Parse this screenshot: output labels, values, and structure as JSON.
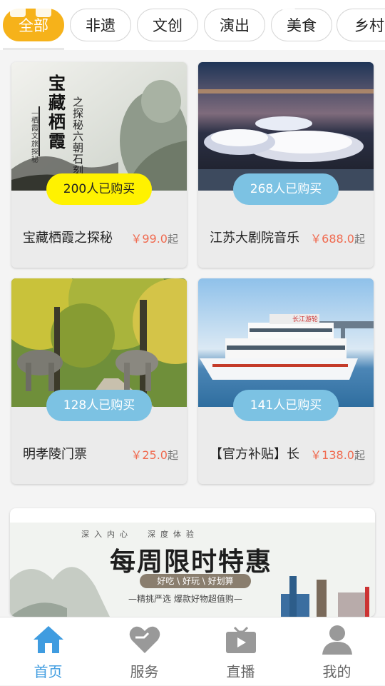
{
  "tabs": [
    {
      "label": "全部",
      "active": true
    },
    {
      "label": "非遗"
    },
    {
      "label": "文创"
    },
    {
      "label": "演出"
    },
    {
      "label": "美食"
    },
    {
      "label": "乡村游"
    }
  ],
  "products": [
    {
      "title": "宝藏栖霞之探秘",
      "price": "￥99.0",
      "unit": "起",
      "sold": "200人已购买",
      "image_text": {
        "main": "宝藏栖霞",
        "sub": "之探秘六朝石刻",
        "side": "—栖霞文旅探秘"
      }
    },
    {
      "title": "江苏大剧院音乐",
      "price": "￥688.0",
      "unit": "起",
      "sold": "268人已购买"
    },
    {
      "title": "明孝陵门票",
      "price": "￥25.0",
      "unit": "起",
      "sold": "128人已购买"
    },
    {
      "title": "【官方补贴】长",
      "price": "￥138.0",
      "unit": "起",
      "sold": "141人已购买",
      "image_text": {
        "boat": "长江游轮"
      }
    }
  ],
  "banner": {
    "top_line": "深  入  内  心        深  度  体  验",
    "title": "每周限时特惠",
    "tags": "好吃 \\ 好玩 \\ 好划算",
    "slogan": "—精挑严选 爆款好物超值购—"
  },
  "nav": [
    {
      "label": "首页",
      "icon": "home-icon",
      "active": true
    },
    {
      "label": "服务",
      "icon": "heart-icon"
    },
    {
      "label": "直播",
      "icon": "live-video-icon"
    },
    {
      "label": "我的",
      "icon": "user-icon"
    }
  ],
  "colors": {
    "accent": "#f6b21a",
    "primary": "#3f9ce0",
    "price": "#f06a4f",
    "badge": "#7cc2e3",
    "badge_hot": "#fff200"
  }
}
